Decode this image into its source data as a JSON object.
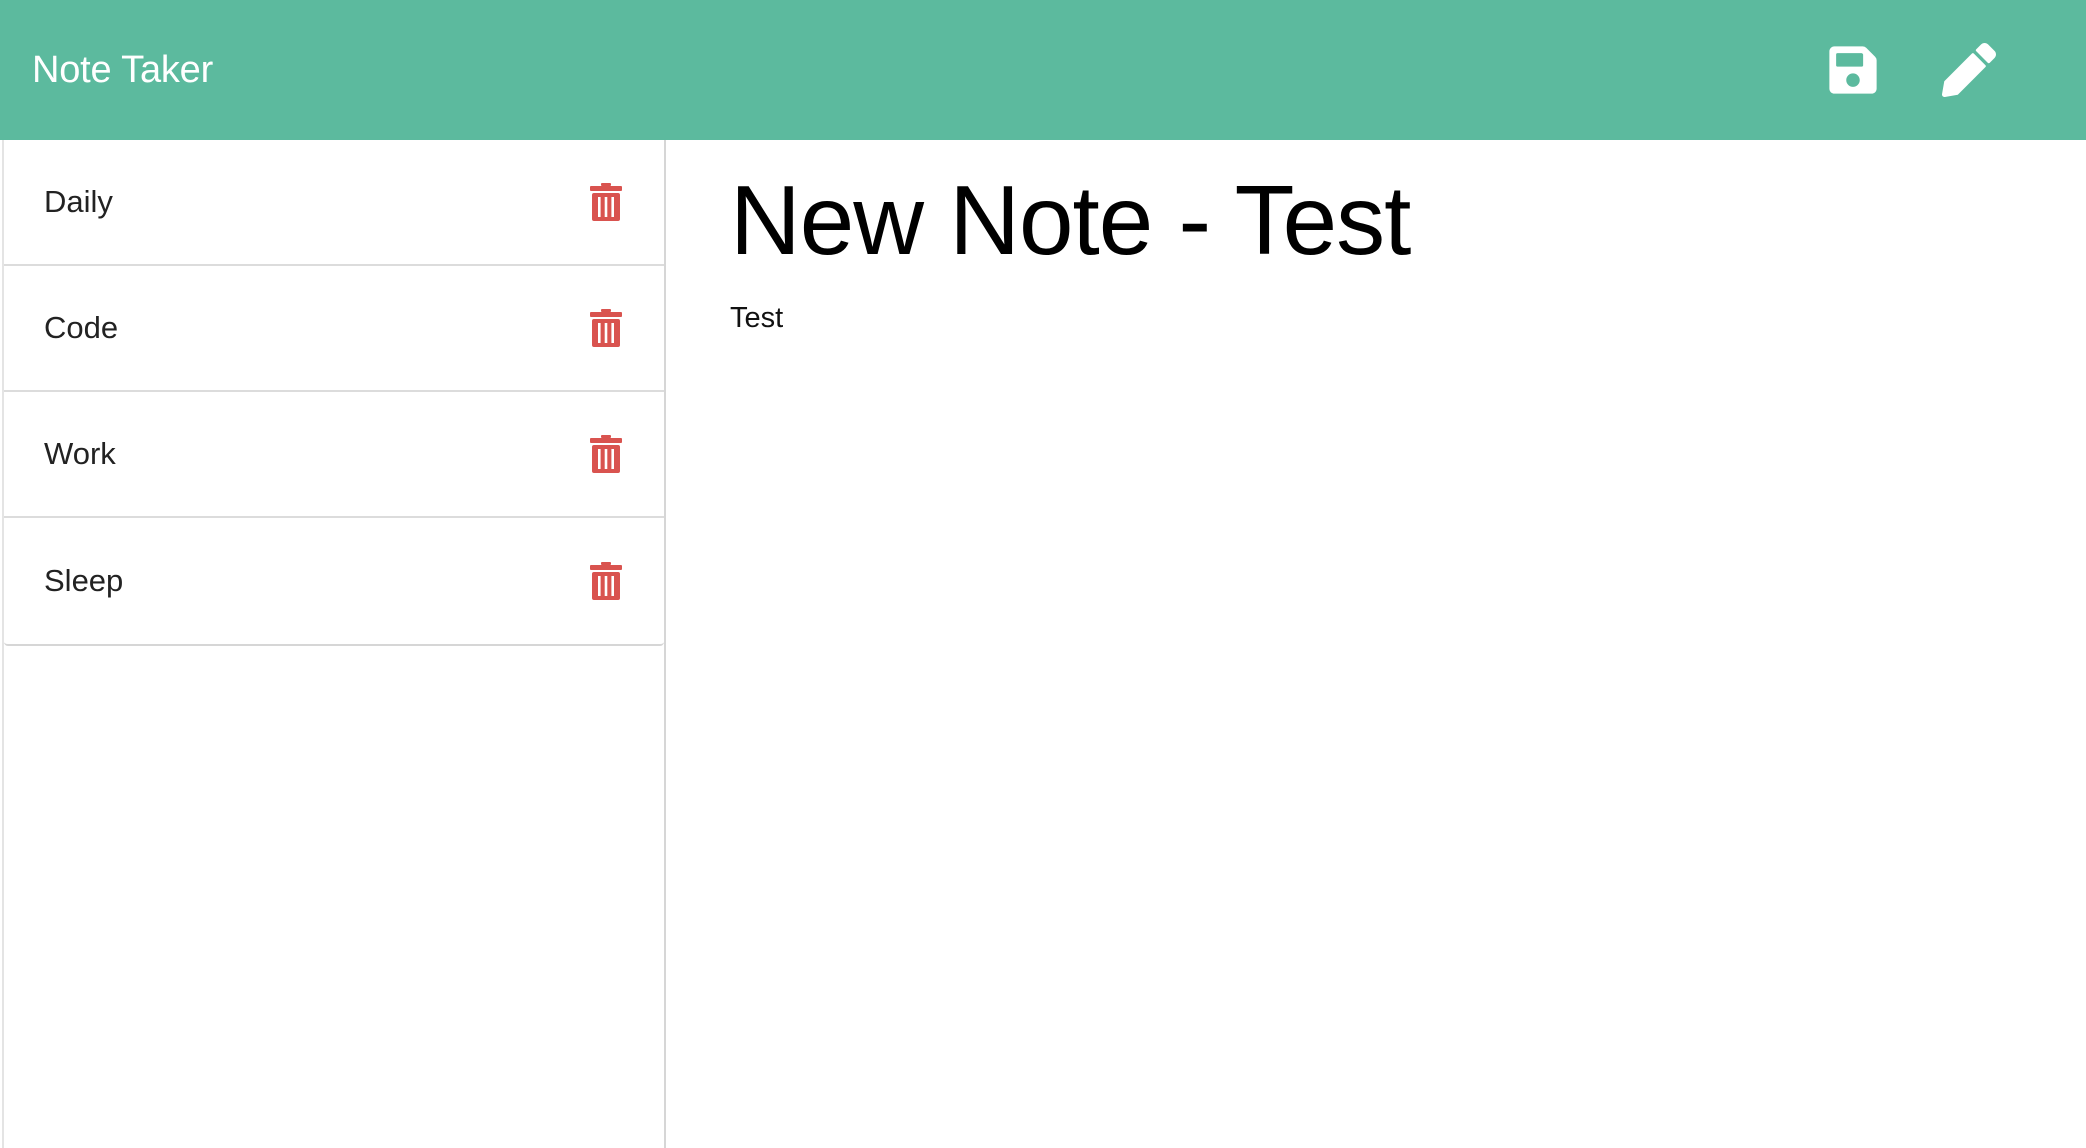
{
  "app": {
    "brand": "Note Taker",
    "colors": {
      "header_bg": "#5cba9e",
      "header_icon": "#ffffff",
      "delete_icon": "#d9534f"
    }
  },
  "toolbar": {
    "save_icon": "floppy-disk-icon",
    "new_icon": "pencil-icon"
  },
  "sidebar": {
    "items": [
      {
        "label": "Daily",
        "icon": "trash-icon"
      },
      {
        "label": "Code",
        "icon": "trash-icon"
      },
      {
        "label": "Work",
        "icon": "trash-icon"
      },
      {
        "label": "Sleep",
        "icon": "trash-icon"
      }
    ]
  },
  "editor": {
    "title_value": "New Note - Test",
    "body_value": "Test"
  }
}
